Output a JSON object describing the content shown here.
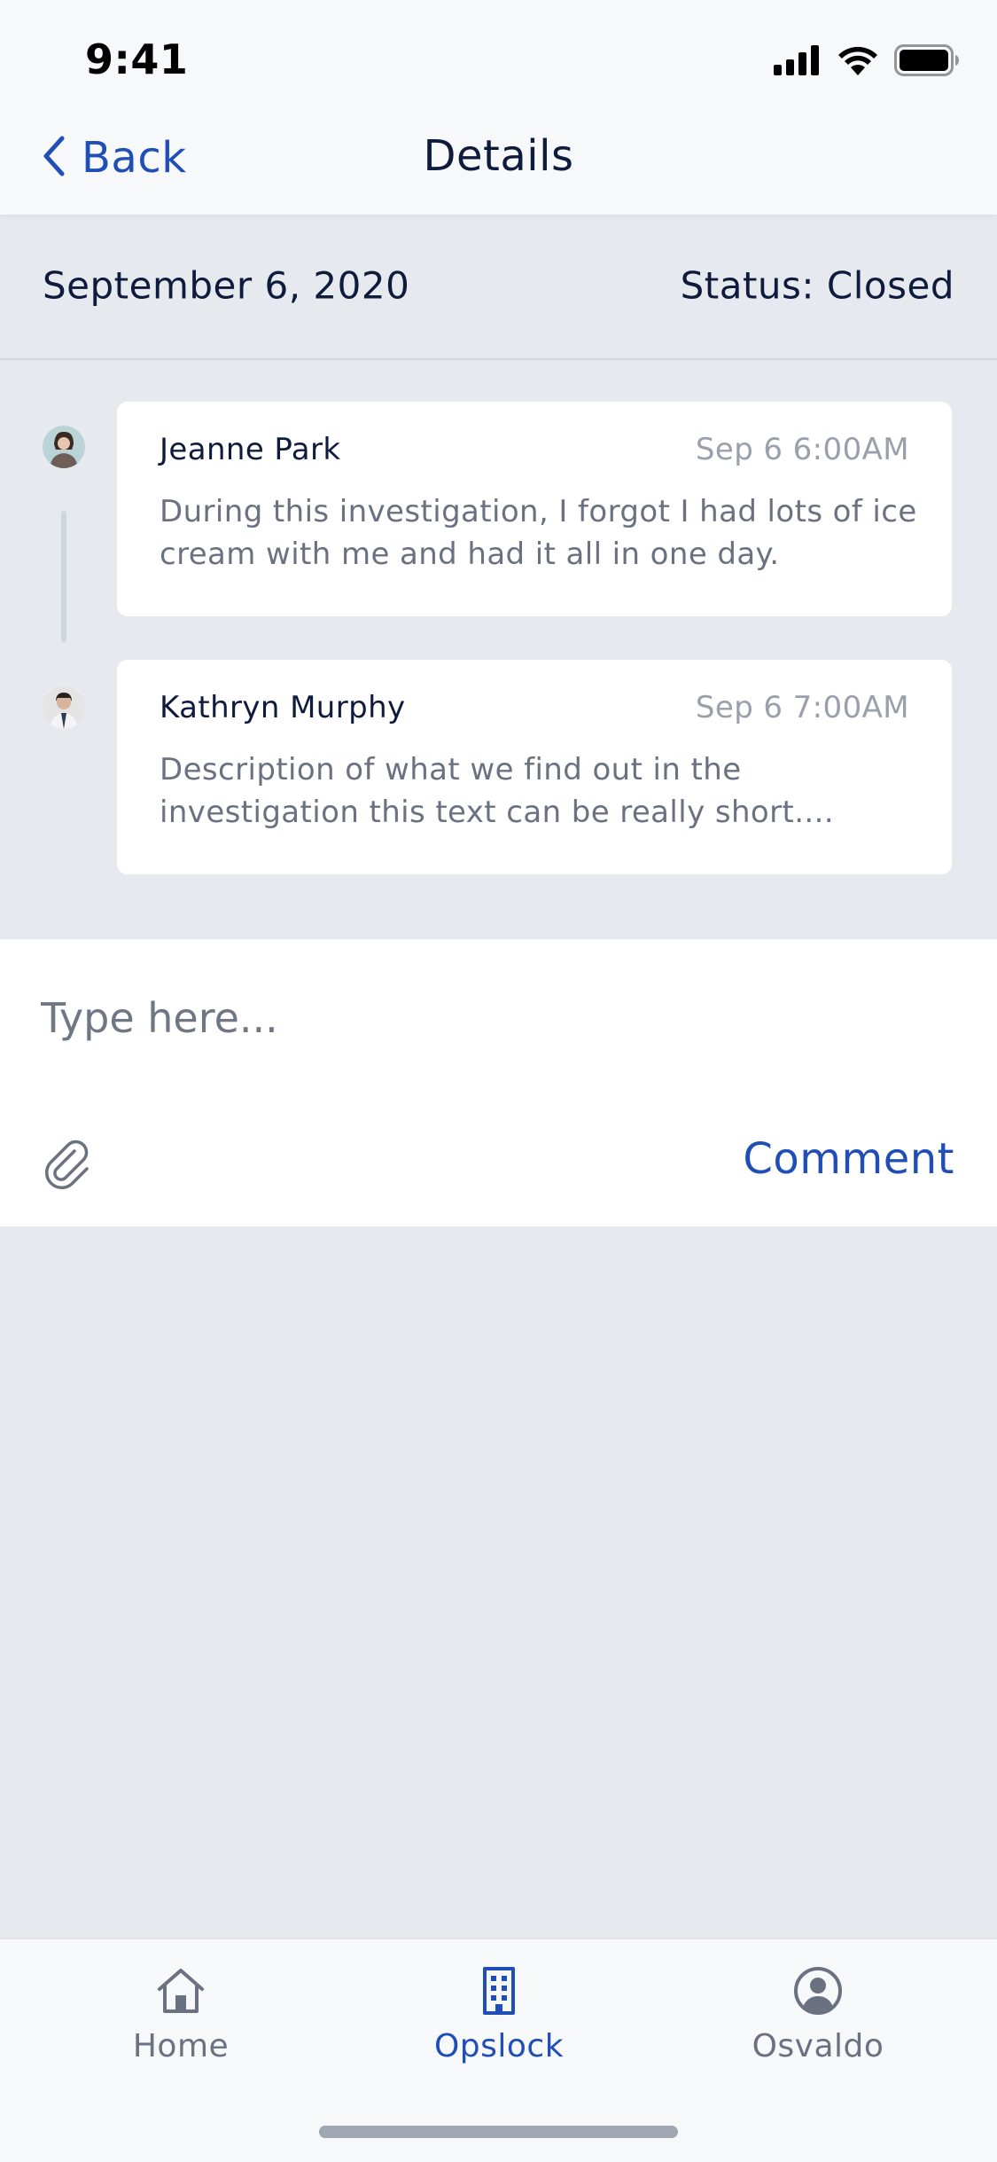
{
  "status_bar": {
    "time": "9:41",
    "icons": [
      "cellular-signal-icon",
      "wifi-icon",
      "battery-icon"
    ]
  },
  "nav": {
    "back_label": "Back",
    "title": "Details"
  },
  "summary": {
    "date": "September 6, 2020",
    "status": "Status: Closed"
  },
  "comments": [
    {
      "author": "Jeanne Park",
      "time": "Sep 6 6:00AM",
      "text": "During this investigation, I forgot I had lots of ice cream with me and had it all in one day."
    },
    {
      "author": "Kathryn Murphy",
      "time": "Sep 6 7:00AM",
      "text": "Description of what we find out in the investigation this text can be really short...."
    }
  ],
  "composer": {
    "placeholder": "Type here...",
    "comment_label": "Comment"
  },
  "tabs": [
    {
      "label": "Home",
      "icon": "home-icon",
      "active": false
    },
    {
      "label": "Opslock",
      "icon": "building-icon",
      "active": true
    },
    {
      "label": "Osvaldo",
      "icon": "user-circle-icon",
      "active": false
    }
  ],
  "colors": {
    "accent": "#1F4FB6",
    "background": "#E6EAEF",
    "surface": "#FFFFFF",
    "bar": "#F7F8FA",
    "text_primary": "#0F1B3D",
    "text_secondary": "#6A7180",
    "text_muted": "#9AA0AB"
  }
}
